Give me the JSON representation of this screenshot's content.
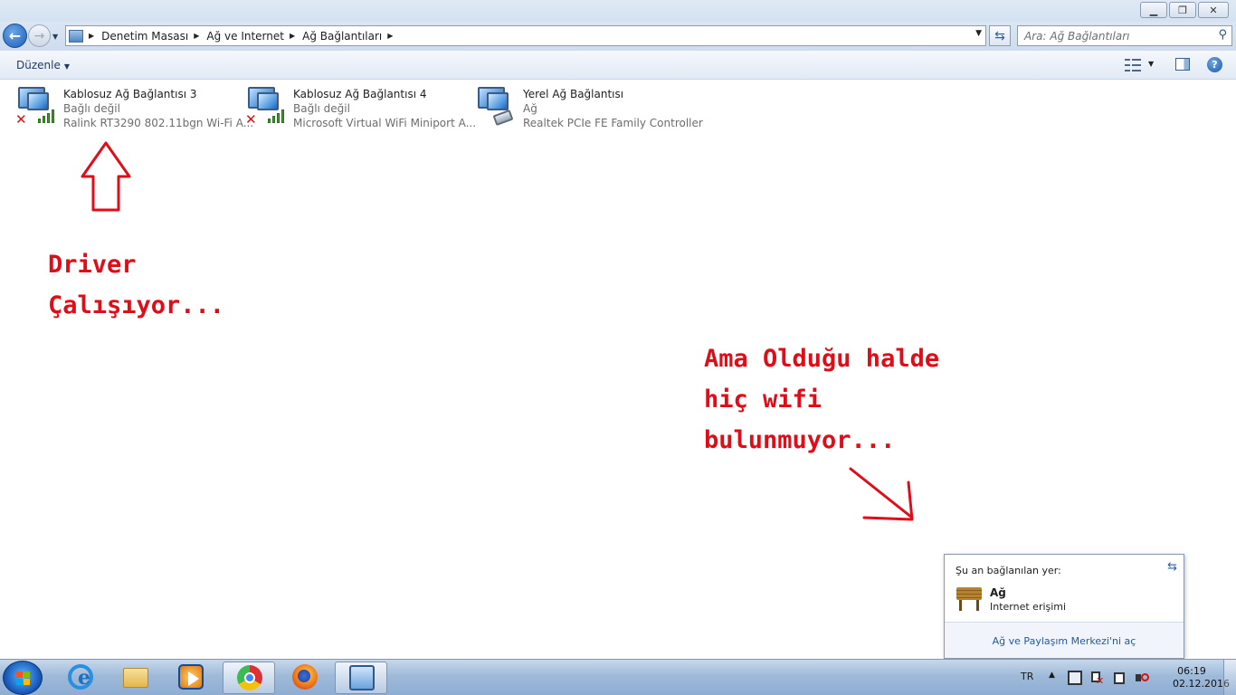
{
  "window": {
    "minimize_glyph": "▁",
    "maximize_glyph": "❐",
    "close_glyph": "✕"
  },
  "address": {
    "breadcrumbs": [
      "Denetim Masası",
      "Ağ ve Internet",
      "Ağ Bağlantıları"
    ],
    "search_placeholder": "Ara: Ağ Bağlantıları"
  },
  "toolbar": {
    "organize_label": "Düzenle",
    "help_glyph": "?"
  },
  "connections": [
    {
      "name": "Kablosuz Ağ Bağlantısı 3",
      "status": "Bağlı değil",
      "device": "Ralink RT3290 802.11bgn Wi-Fi A...",
      "type": "wireless",
      "disconnected": true
    },
    {
      "name": "Kablosuz Ağ Bağlantısı 4",
      "status": "Bağlı değil",
      "device": "Microsoft Virtual WiFi Miniport A...",
      "type": "wireless",
      "disconnected": true
    },
    {
      "name": "Yerel Ağ Bağlantısı",
      "status": "Ağ",
      "device": "Realtek PCIe FE Family Controller",
      "type": "ethernet",
      "disconnected": false
    }
  ],
  "annotations": {
    "left_line1": "Driver",
    "left_line2": "Çalışıyor...",
    "right_line1": "Ama Olduğu halde",
    "right_line2": "hiç wifi",
    "right_line3": "bulunmuyor...",
    "color": "#e00d18"
  },
  "flyout": {
    "heading": "Şu an bağlanılan yer:",
    "network_name": "Ağ",
    "access": "Internet erişimi",
    "link": "Ağ ve Paylaşım Merkezi'ni aç"
  },
  "taskbar": {
    "apps": [
      "internet-explorer",
      "windows-explorer",
      "windows-media-player",
      "google-chrome",
      "mozilla-firefox",
      "network-connections"
    ],
    "active_app": "network-connections",
    "language": "TR",
    "time": "06:19",
    "date": "02.12.2016"
  }
}
